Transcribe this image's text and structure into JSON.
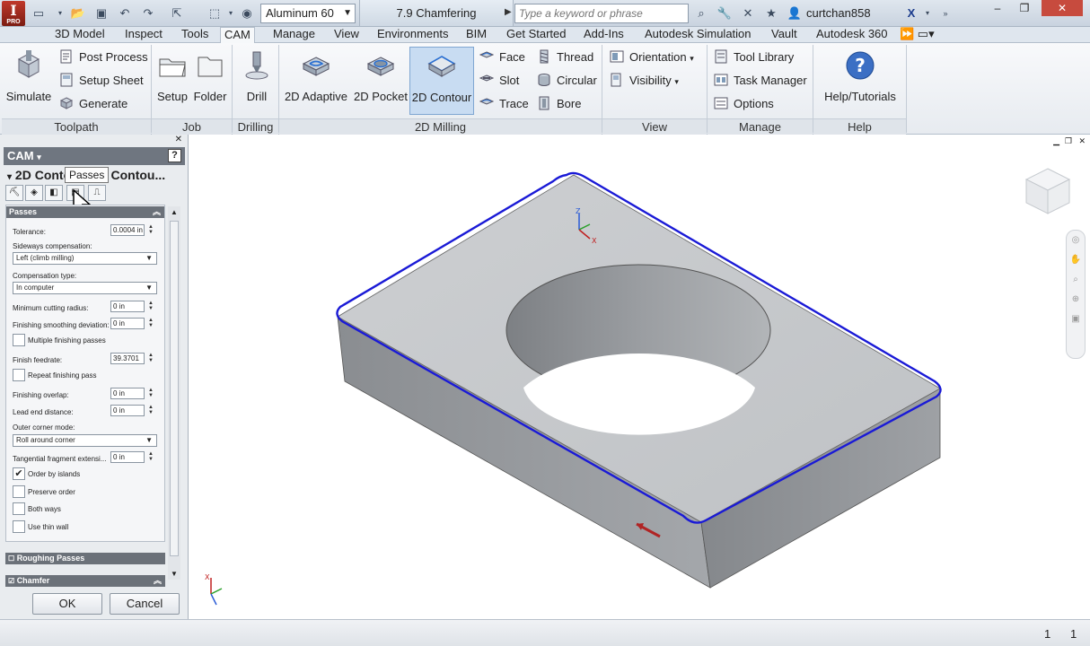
{
  "titlebar": {
    "app_logo_letter": "I",
    "app_logo_sub": "PRO",
    "material": "Aluminum 60",
    "document_title": "7.9 Chamfering",
    "search_placeholder": "Type a keyword or phrase",
    "user": "curtchan858"
  },
  "tabs": [
    "3D Model",
    "Inspect",
    "Tools",
    "CAM",
    "Manage",
    "View",
    "Environments",
    "BIM",
    "Get Started",
    "Add-Ins",
    "Autodesk Simulation",
    "Vault",
    "Autodesk 360"
  ],
  "active_tab": "CAM",
  "ribbon": {
    "toolpath": {
      "label": "Toolpath",
      "simulate": "Simulate",
      "post_process": "Post Process",
      "setup_sheet": "Setup Sheet",
      "generate": "Generate"
    },
    "job": {
      "label": "Job",
      "setup": "Setup",
      "folder": "Folder"
    },
    "drilling": {
      "label": "Drilling",
      "drill": "Drill"
    },
    "milling": {
      "label": "2D Milling",
      "adaptive": "2D Adaptive",
      "pocket": "2D Pocket",
      "contour": "2D Contour",
      "face": "Face",
      "slot": "Slot",
      "trace": "Trace",
      "thread": "Thread",
      "circular": "Circular",
      "bore": "Bore"
    },
    "view": {
      "label": "View",
      "orientation": "Orientation",
      "visibility": "Visibility"
    },
    "manage": {
      "label": "Manage",
      "tool_library": "Tool Library",
      "task_manager": "Task Manager",
      "options": "Options"
    },
    "help": {
      "label": "Help",
      "help_tutorials": "Help/Tutorials"
    }
  },
  "panel": {
    "header": "CAM",
    "operation_title": "2D Contour: 2D Contou...",
    "tooltip": "Passes",
    "passes_section": "Passes",
    "fields": {
      "tolerance_label": "Tolerance:",
      "tolerance": "0.0004 in",
      "sideways_label": "Sideways compensation:",
      "sideways": "Left (climb milling)",
      "comp_type_label": "Compensation type:",
      "comp_type": "In computer",
      "min_radius_label": "Minimum cutting radius:",
      "min_radius": "0 in",
      "smoothing_label": "Finishing smoothing deviation:",
      "smoothing": "0 in",
      "multiple_label": "Multiple finishing passes",
      "feedrate_label": "Finish feedrate:",
      "feedrate": "39.3701 in",
      "repeat_label": "Repeat finishing pass",
      "overlap_label": "Finishing overlap:",
      "overlap": "0 in",
      "lead_end_label": "Lead end distance:",
      "lead_end": "0 in",
      "outer_corner_label": "Outer corner mode:",
      "outer_corner": "Roll around corner",
      "tangential_label": "Tangential fragment extensi...",
      "tangential": "0 in",
      "order_islands_label": "Order by islands",
      "preserve_label": "Preserve order",
      "both_ways_label": "Both ways",
      "thin_wall_label": "Use thin wall"
    },
    "roughing_section": "Roughing Passes",
    "chamfer_section": "Chamfer",
    "ok": "OK",
    "cancel": "Cancel"
  },
  "statusbar": {
    "left_count": "1",
    "right_count": "1"
  },
  "colors": {
    "toolpath": "#1a1ad6",
    "accent": "#c8dcf2"
  }
}
